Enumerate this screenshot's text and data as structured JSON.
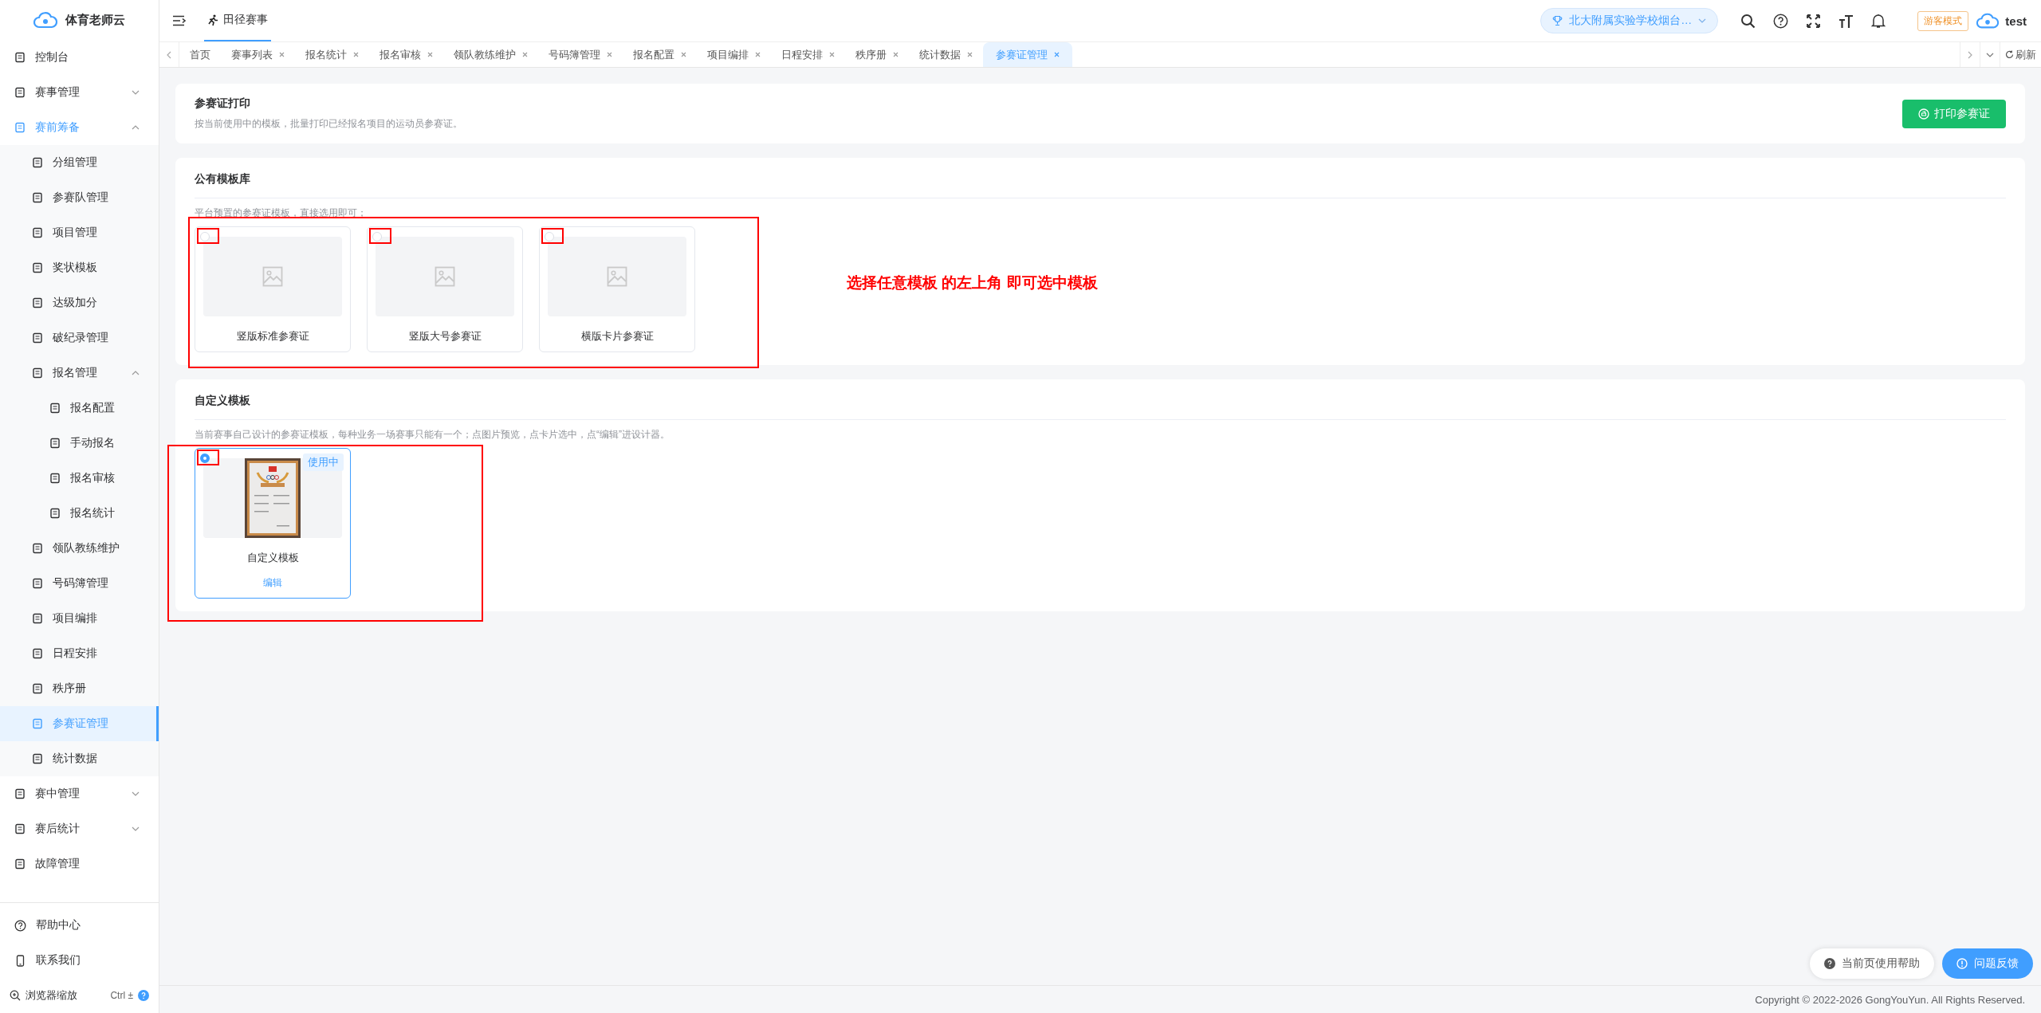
{
  "app": {
    "name": "体育老师云"
  },
  "sidebar": {
    "items": [
      {
        "label": "控制台",
        "selected": false
      },
      {
        "label": "赛事管理",
        "selected": false,
        "expanded": false
      },
      {
        "label": "赛前筹备",
        "selected": false,
        "expanded": true,
        "children": [
          {
            "label": "分组管理",
            "selected": false
          },
          {
            "label": "参赛队管理",
            "selected": false
          },
          {
            "label": "项目管理",
            "selected": false
          },
          {
            "label": "奖状模板",
            "selected": false
          },
          {
            "label": "达级加分",
            "selected": false
          },
          {
            "label": "破纪录管理",
            "selected": false
          },
          {
            "label": "报名管理",
            "selected": false,
            "expanded": true,
            "children": [
              {
                "label": "报名配置",
                "selected": false
              },
              {
                "label": "手动报名",
                "selected": false
              },
              {
                "label": "报名审核",
                "selected": false
              },
              {
                "label": "报名统计",
                "selected": false
              }
            ]
          },
          {
            "label": "领队教练维护",
            "selected": false
          },
          {
            "label": "号码簿管理",
            "selected": false
          },
          {
            "label": "项目编排",
            "selected": false
          },
          {
            "label": "日程安排",
            "selected": false
          },
          {
            "label": "秩序册",
            "selected": false
          },
          {
            "label": "参赛证管理",
            "selected": true
          },
          {
            "label": "统计数据",
            "selected": false
          }
        ]
      },
      {
        "label": "赛中管理",
        "selected": false,
        "expanded": false
      },
      {
        "label": "赛后统计",
        "selected": false,
        "expanded": false
      },
      {
        "label": "故障管理",
        "selected": false
      }
    ],
    "footer": [
      {
        "label": "帮助中心"
      },
      {
        "label": "联系我们"
      }
    ],
    "zoom": {
      "label": "浏览器缩放",
      "shortcut": "Ctrl ±"
    }
  },
  "header": {
    "module": "田径赛事",
    "school": "北大附属实验学校烟台…",
    "mode": "游客模式",
    "user": "test"
  },
  "tabs": [
    {
      "label": "首页",
      "selected": false,
      "closable": false
    },
    {
      "label": "赛事列表",
      "selected": false,
      "closable": true
    },
    {
      "label": "报名统计",
      "selected": false,
      "closable": true
    },
    {
      "label": "报名审核",
      "selected": false,
      "closable": true
    },
    {
      "label": "领队教练维护",
      "selected": false,
      "closable": true
    },
    {
      "label": "号码簿管理",
      "selected": false,
      "closable": true
    },
    {
      "label": "报名配置",
      "selected": false,
      "closable": true
    },
    {
      "label": "项目编排",
      "selected": false,
      "closable": true
    },
    {
      "label": "日程安排",
      "selected": false,
      "closable": true
    },
    {
      "label": "秩序册",
      "selected": false,
      "closable": true
    },
    {
      "label": "统计数据",
      "selected": false,
      "closable": true
    },
    {
      "label": "参赛证管理",
      "selected": true,
      "closable": true
    }
  ],
  "refresh": "刷新",
  "print_card": {
    "title": "参赛证打印",
    "description": "按当前使用中的模板，批量打印已经报名项目的运动员参赛证。",
    "button": "打印参赛证"
  },
  "public_templates": {
    "title": "公有模板库",
    "description": "平台预置的参赛证模板，直接选用即可；",
    "highlighted": true,
    "templates": [
      {
        "name": "竖版标准参赛证",
        "selected": false,
        "highlighted": true
      },
      {
        "name": "竖版大号参赛证",
        "selected": false,
        "highlighted": true
      },
      {
        "name": "横版卡片参赛证",
        "selected": false,
        "highlighted": true
      }
    ]
  },
  "custom_templates": {
    "title": "自定义模板",
    "description": "当前赛事自己设计的参赛证模板，每种业务一场赛事只能有一个；点图片预览，点卡片选中，点“编辑”进设计器。",
    "highlighted": true,
    "templates": [
      {
        "name": "自定义模板",
        "selected": true,
        "highlighted": true,
        "badge": "使用中",
        "action": "编辑",
        "kind": "picture"
      }
    ]
  },
  "annotation": {
    "text": "选择任意模板 的左上角 即可选中模板"
  },
  "help_buttons": [
    {
      "label": "当前页使用帮助",
      "kind": "help"
    },
    {
      "label": "问题反馈",
      "kind": "feedback"
    }
  ],
  "copyright": "Copyright © 2022-2026 GongYouYun. All Rights Reserved."
}
